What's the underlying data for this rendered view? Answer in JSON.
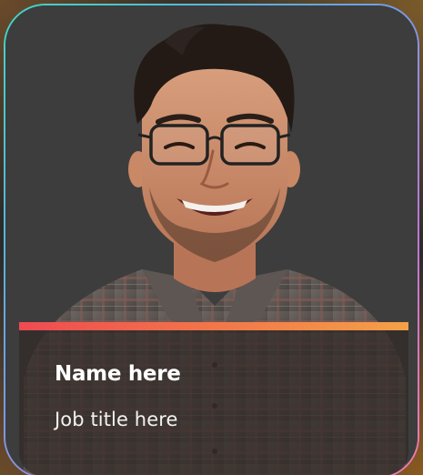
{
  "profile_card": {
    "name": "Name here",
    "job_title": "Job title here",
    "photo": "portrait-photo",
    "accent_colors": [
      "#ef4a52",
      "#f4a047"
    ],
    "border_colors": [
      "#3fd6c4",
      "#6aa2e8",
      "#b67ad8",
      "#f07aa8"
    ]
  }
}
